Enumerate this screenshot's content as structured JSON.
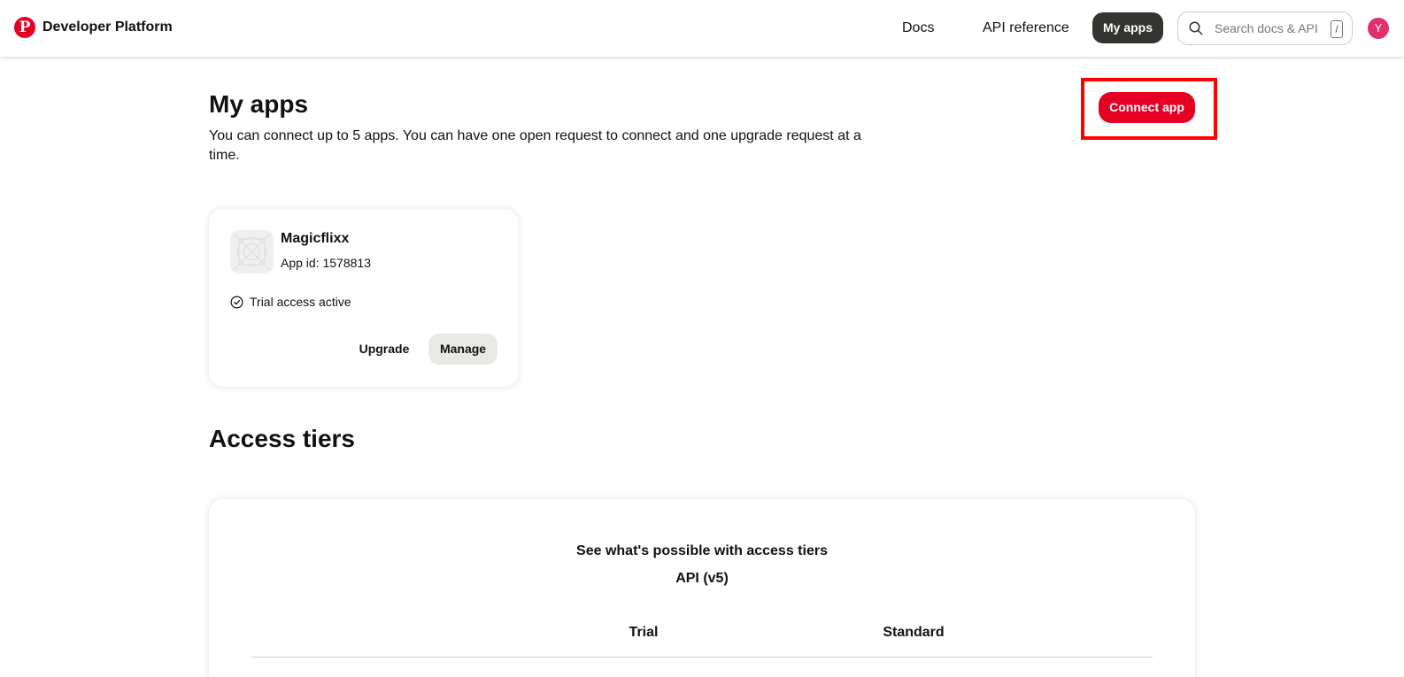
{
  "header": {
    "brand": "Developer Platform",
    "logo_letter": "P",
    "nav": [
      {
        "label": "Docs"
      },
      {
        "label": "API reference"
      },
      {
        "label": "My apps"
      }
    ],
    "search_placeholder": "Search docs & API",
    "search_shortcut": "/",
    "avatar_initial": "Y",
    "brand_color": "#e60023"
  },
  "main": {
    "title": "My apps",
    "description": "You can connect up to 5 apps. You can have one open request to connect and one upgrade request at a time.",
    "connect_button": "Connect app",
    "app": {
      "name": "Magicflixx",
      "app_id": "App id: 1578813",
      "status": "Trial access active",
      "upgrade_label": "Upgrade",
      "manage_label": "Manage"
    }
  },
  "access_tiers": {
    "title": "Access tiers",
    "heading": "See what's possible with access tiers",
    "subheading": "API (v5)",
    "columns": [
      "Trial",
      "Standard"
    ]
  }
}
